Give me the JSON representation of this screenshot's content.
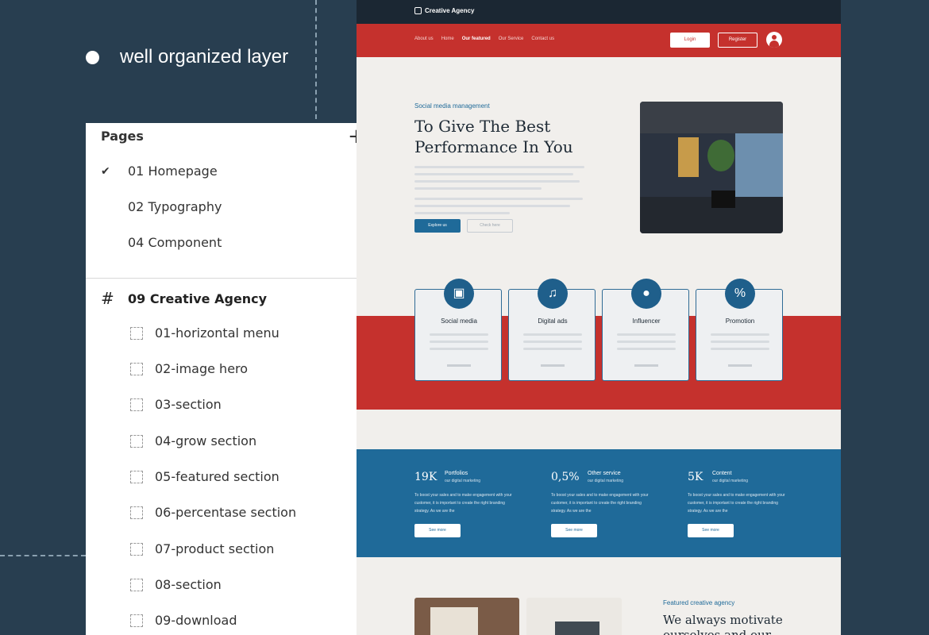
{
  "caption": "well organized layer",
  "layers_panel": {
    "header": "Pages",
    "add_icon": "plus-icon",
    "pages": [
      "01 Homepage",
      "02 Typography",
      "04 Component"
    ],
    "selected_page": "01 Homepage",
    "frame": "09 Creative Agency",
    "layers": [
      "01-horizontal menu",
      "02-image hero",
      "03-section",
      "04-grow section",
      "05-featured section",
      "06-percentase section",
      "07-product section",
      "08-section",
      "09-download"
    ]
  },
  "site": {
    "brand": "Creative Agency",
    "nav": [
      "About us",
      "Home",
      "Our featured",
      "Our Service",
      "Contact us"
    ],
    "nav_active": "Our featured",
    "login": "Login",
    "register": "Register",
    "hero": {
      "eyebrow": "Social media management",
      "title": "To Give The Best Performance In You",
      "primary_button": "Explore us",
      "secondary_button": "Check here"
    },
    "services": [
      {
        "title": "Social media",
        "icon": "square-icon"
      },
      {
        "title": "Digital ads",
        "icon": "headphones-icon"
      },
      {
        "title": "Influencer",
        "icon": "user-icon"
      },
      {
        "title": "Promotion",
        "icon": "percent-icon"
      }
    ],
    "stats": [
      {
        "number": "19K",
        "label": "Portfolios",
        "sub": "our digital marketing",
        "text": "To boost your sales and to make engagement with your customer, it is important to create the right branding strategy. As we are the",
        "button": "See more"
      },
      {
        "number": "0,5%",
        "label": "Other service",
        "sub": "our digital marketing",
        "text": "To boost your sales and to make engagement with your customer, it is important to create the right branding strategy. As we are the",
        "button": "See more"
      },
      {
        "number": "5K",
        "label": "Content",
        "sub": "our digital marketing",
        "text": "To boost your sales and to make engagement with your customer, it is important to create the right branding strategy. As we are the",
        "button": "See more"
      }
    ],
    "featured": {
      "eyebrow": "Featured creative agency",
      "title": "We always motivate ourselves and our"
    },
    "colors": {
      "dark": "#1b2733",
      "red": "#c5312d",
      "blue": "#1f6a99",
      "background": "#283e50"
    }
  }
}
